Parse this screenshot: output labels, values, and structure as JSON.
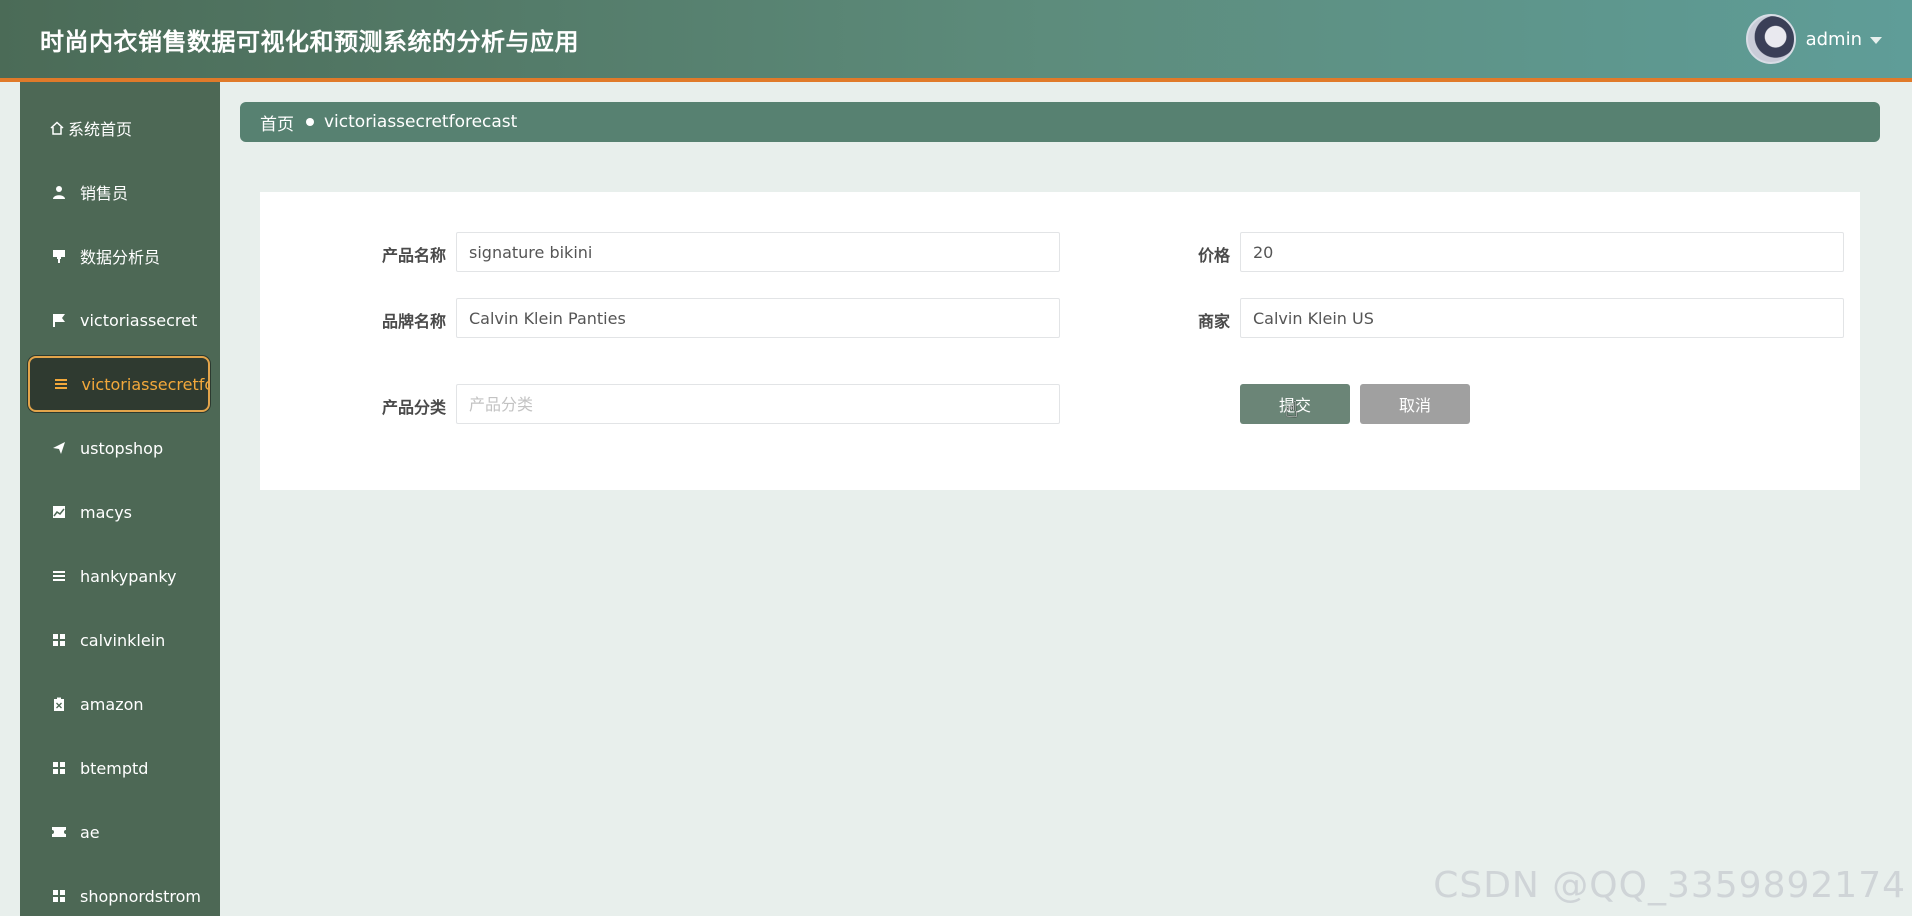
{
  "header": {
    "title": "时尚内衣销售数据可视化和预测系统的分析与应用",
    "username": "admin"
  },
  "sidebar": {
    "items": [
      {
        "label": "系统首页",
        "icon": "home-icon"
      },
      {
        "label": "销售员",
        "icon": "user-icon"
      },
      {
        "label": "数据分析员",
        "icon": "chart-pin-icon"
      },
      {
        "label": "victoriassecret",
        "icon": "flag-icon"
      },
      {
        "label": "victoriassecretforecast",
        "icon": "list-icon",
        "active": true
      },
      {
        "label": "ustopshop",
        "icon": "paper-plane-icon"
      },
      {
        "label": "macys",
        "icon": "area-chart-icon"
      },
      {
        "label": "hankypanky",
        "icon": "bars-icon"
      },
      {
        "label": "calvinklein",
        "icon": "grid-icon"
      },
      {
        "label": "amazon",
        "icon": "clipboard-icon"
      },
      {
        "label": "btemptd",
        "icon": "grid-icon"
      },
      {
        "label": "ae",
        "icon": "ticket-icon"
      },
      {
        "label": "shopnordstrom",
        "icon": "grid-icon"
      }
    ]
  },
  "breadcrumb": {
    "home": "首页",
    "current": "victoriassecretforecast"
  },
  "form": {
    "product_name": {
      "label": "产品名称",
      "value": "signature bikini"
    },
    "price": {
      "label": "价格",
      "value": "20"
    },
    "brand_name": {
      "label": "品牌名称",
      "value": "Calvin Klein Panties"
    },
    "merchant": {
      "label": "商家",
      "value": "Calvin Klein US"
    },
    "category": {
      "label": "产品分类",
      "value": "",
      "placeholder": "产品分类"
    },
    "submit_label": "提交",
    "cancel_label": "取消"
  },
  "colors": {
    "accent": "#578171",
    "active_text": "#f3a83b",
    "header_border": "#e07a2a"
  },
  "watermark": "CSDN @QQ_3359892174"
}
